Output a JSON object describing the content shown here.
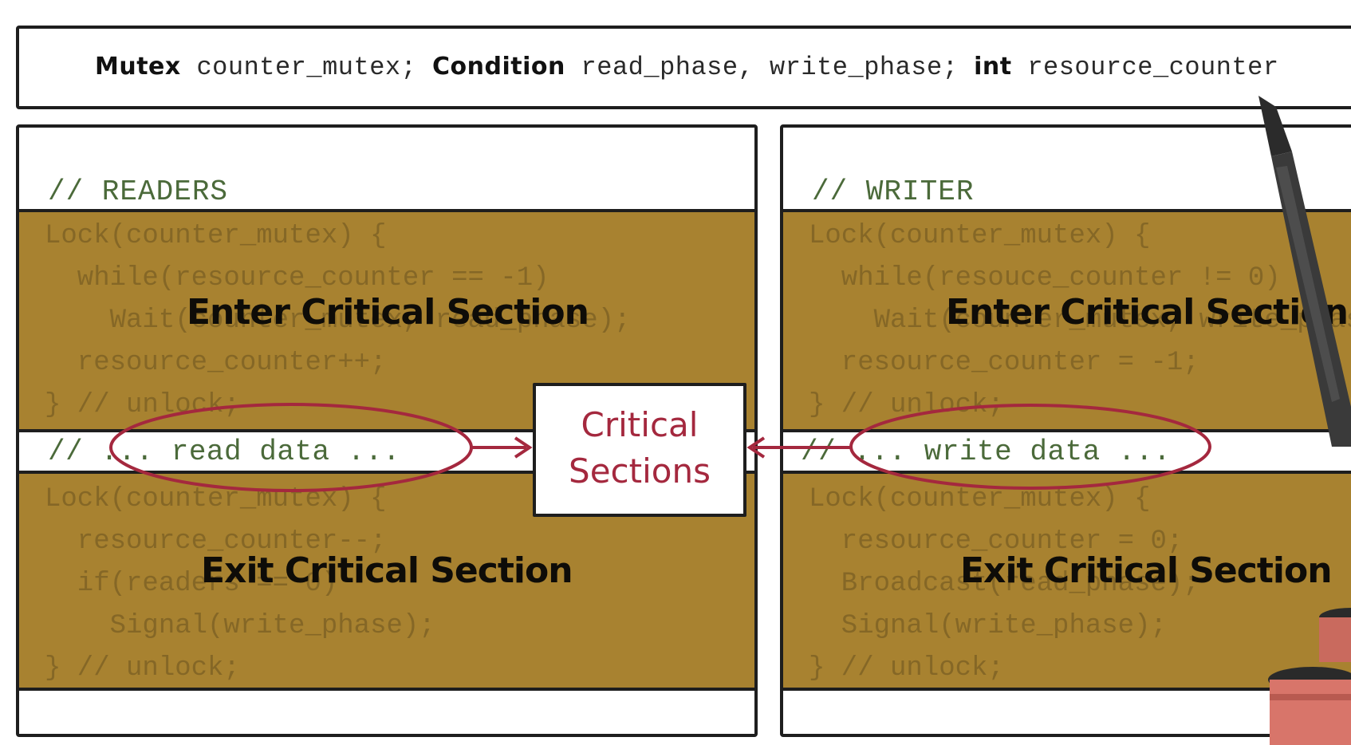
{
  "declaration": {
    "kw_mutex": "Mutex",
    "mutex_var": " counter_mutex; ",
    "kw_condition": "Condition",
    "condition_vars": " read_phase, write_phase; ",
    "kw_int": "int",
    "int_var": " resource_counter"
  },
  "readers": {
    "header": "// READERS",
    "enter_code": "Lock(counter_mutex) {\n  while(resource_counter == -1)\n    Wait(counter_mutex, read_phase);\n  resource_counter++;\n} // unlock;",
    "enter_label": "Enter Critical Section",
    "data_line": "// ... read data ...",
    "exit_code": "Lock(counter_mutex) {\n  resource_counter--;\n  if(readers == 0)\n    Signal(write_phase);\n} // unlock;",
    "exit_label": "Exit Critical Section"
  },
  "writer": {
    "header": "// WRITER",
    "enter_code": "Lock(counter_mutex) {\n  while(resouce_counter != 0)\n    Wait(counter_mutex, write_phase);\n  resource_counter = -1;\n} // unlock;",
    "enter_label": "Enter Critical Section",
    "data_line": "// ... write data ...",
    "exit_code": "Lock(counter_mutex) {\n  resource_counter = 0;\n  Broadcast(read_phase);\n  Signal(write_phase);\n} // unlock;",
    "exit_label": "Exit Critical Section"
  },
  "critical_box": {
    "line1": "Critical",
    "line2": "Sections"
  },
  "colors": {
    "band": "#a88230",
    "annotation": "#a4283e",
    "code_green": "#4b6a3a"
  }
}
